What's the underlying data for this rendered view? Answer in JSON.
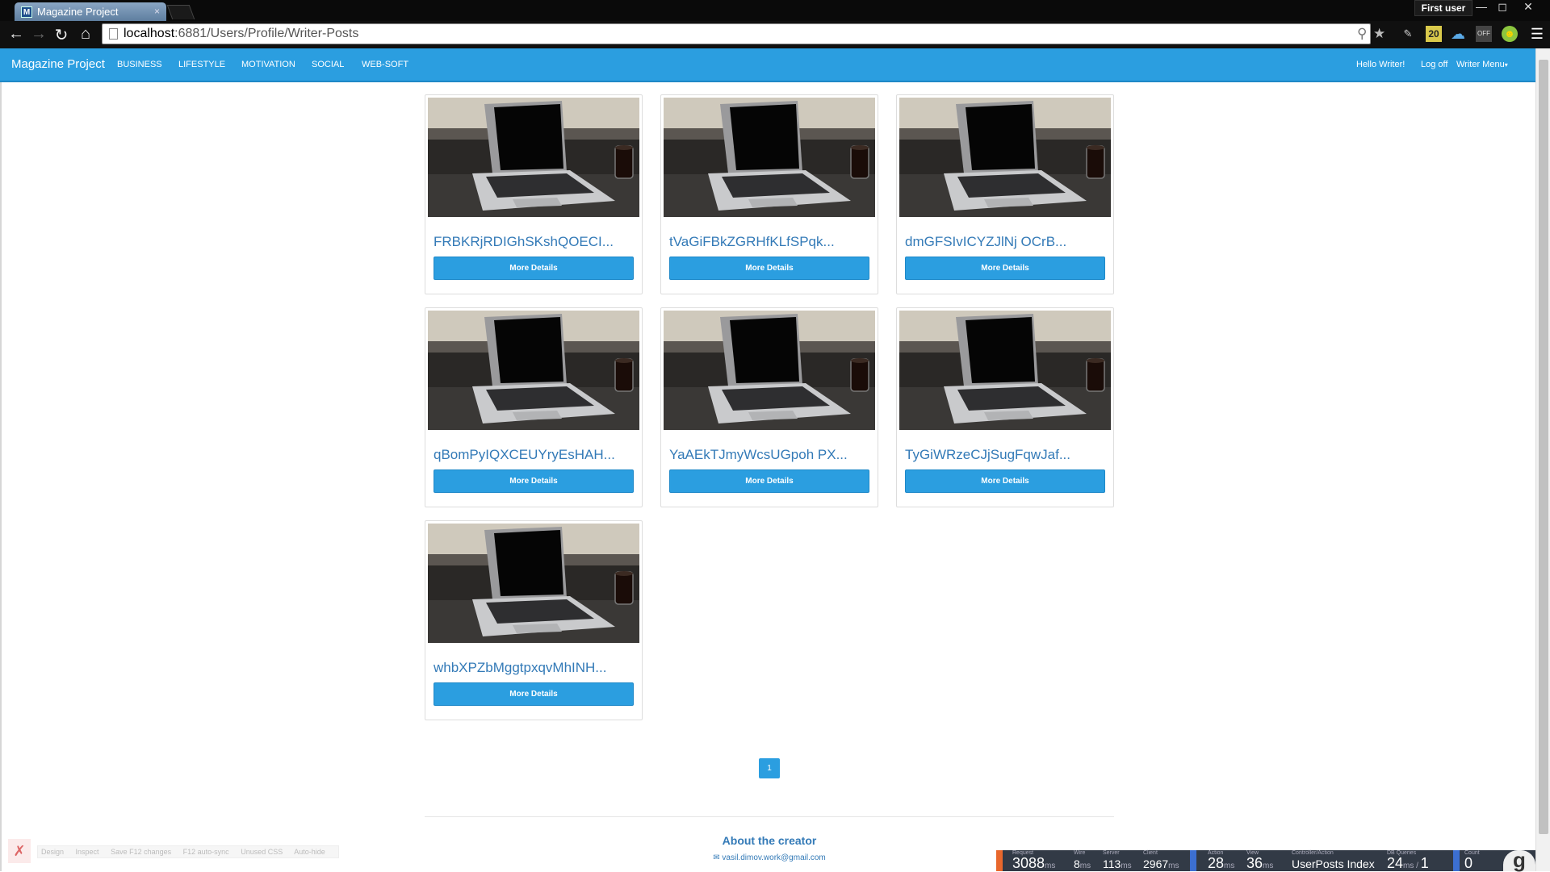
{
  "browser": {
    "tab_title": "Magazine Project",
    "tab_close": "×",
    "favicon": "M",
    "profile": "First user",
    "window_buttons": [
      "—",
      "◻",
      "✕"
    ],
    "url_host": "localhost",
    "url_path": ":6881/Users/Profile/Writer-Posts",
    "extension_badge": "20",
    "extension_off": "OFF"
  },
  "navbar": {
    "brand": "Magazine Project",
    "links": [
      "BUSINESS",
      "LIFESTYLE",
      "MOTIVATION",
      "SOCIAL",
      "WEB-SOFT"
    ],
    "greeting": "Hello Writer!",
    "logoff": "Log off",
    "writer_menu": "Writer Menu"
  },
  "posts": [
    {
      "title": "FRBKRjRDIGhSKshQOECI...",
      "button": "More Details"
    },
    {
      "title": "tVaGiFBkZGRHfKLfSPqk...",
      "button": "More Details"
    },
    {
      "title": "dmGFSIvICYZJlNj OCrB...",
      "button": "More Details"
    },
    {
      "title": "qBomPyIQXCEUYryEsHAH...",
      "button": "More Details"
    },
    {
      "title": "YaAEkTJmyWcsUGpoh PX...",
      "button": "More Details"
    },
    {
      "title": "TyGiWRzeCJjSugFqwJaf...",
      "button": "More Details"
    },
    {
      "title": "whbXPZbMggtpxqvMhINH...",
      "button": "More Details"
    }
  ],
  "pagination": {
    "current": "1"
  },
  "footer": {
    "about": "About the creator",
    "email": "vasil.dimov.work@gmail.com"
  },
  "browser_link": {
    "items": [
      "Design",
      "Inspect",
      "Save F12 changes",
      "F12 auto-sync",
      "Unused CSS",
      "Auto-hide"
    ]
  },
  "glimpse": {
    "request_label": "Request",
    "request": "3088",
    "request_unit": "ms",
    "wire_label": "Wire",
    "wire": "8",
    "wire_unit": "ms",
    "server_label": "Server",
    "server": "113",
    "server_unit": "ms",
    "client_label": "Client",
    "client": "2967",
    "client_unit": "ms",
    "action_label": "Action",
    "action": "28",
    "action_unit": "ms",
    "view_label": "View",
    "view": "36",
    "view_unit": "ms",
    "controller_label": "Controller/Action",
    "controller": "UserPosts Index",
    "db_label": "DB Queries",
    "db": "24",
    "db_unit": "ms",
    "db_count": "1",
    "ajax_label": "Count",
    "ajax": "0",
    "logo": "g"
  },
  "colors": {
    "accent": "#2b9ee0",
    "link": "#337ab7",
    "glimpse_bg": "#323a46"
  }
}
